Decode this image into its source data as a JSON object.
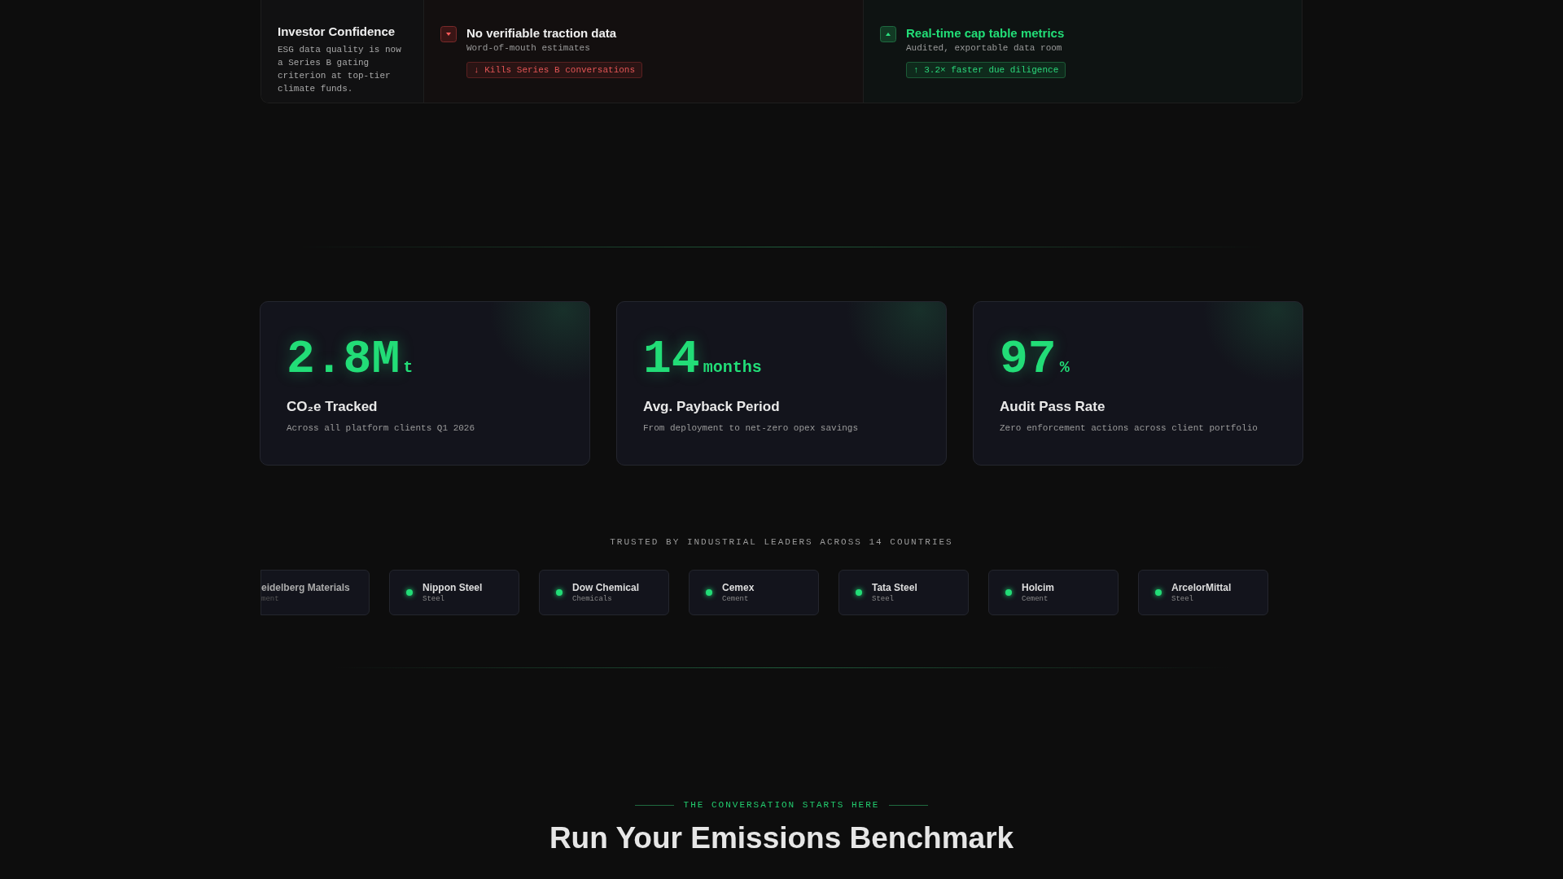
{
  "comparison": {
    "label": {
      "title": "Investor Confidence",
      "text": "ESG data quality is now a Series B gating criterion at top-tier climate funds."
    },
    "cells": [
      {
        "kind": "bad",
        "title": "No verifiable traction data",
        "subtitle": "Word-of-mouth estimates",
        "tag": "↓ Kills Series B conversations"
      },
      {
        "kind": "good",
        "title": "Real-time cap table metrics",
        "subtitle": "Audited, exportable data room",
        "tag": "↑ 3.2× faster due diligence"
      }
    ]
  },
  "stats": [
    {
      "value": "2.8M",
      "unit": "t",
      "title": "CO₂e Tracked",
      "text": "Across all platform clients Q1 2026"
    },
    {
      "value": "14",
      "unit": "months",
      "title": "Avg. Payback Period",
      "text": "From deployment to net-zero opex savings"
    },
    {
      "value": "97",
      "unit": "%",
      "title": "Audit Pass Rate",
      "text": "Zero enforcement actions across client portfolio"
    }
  ],
  "trusted": {
    "heading": "TRUSTED BY INDUSTRIAL LEADERS ACROSS 14 COUNTRIES",
    "logos": [
      {
        "kind": "cut",
        "name": "eidelberg Materials",
        "sector": "ment"
      },
      {
        "kind": "full",
        "name": "Nippon Steel",
        "sector": "Steel"
      },
      {
        "kind": "full",
        "name": "Dow Chemical",
        "sector": "Chemicals"
      },
      {
        "kind": "full",
        "name": "Cemex",
        "sector": "Cement"
      },
      {
        "kind": "full",
        "name": "Tata Steel",
        "sector": "Steel"
      },
      {
        "kind": "full",
        "name": "Holcim",
        "sector": "Cement"
      },
      {
        "kind": "full",
        "name": "ArcelorMittal",
        "sector": "Steel"
      }
    ]
  },
  "cta": {
    "eyebrow": "THE CONVERSATION STARTS HERE",
    "heading": "Run Your Emissions Benchmark"
  }
}
